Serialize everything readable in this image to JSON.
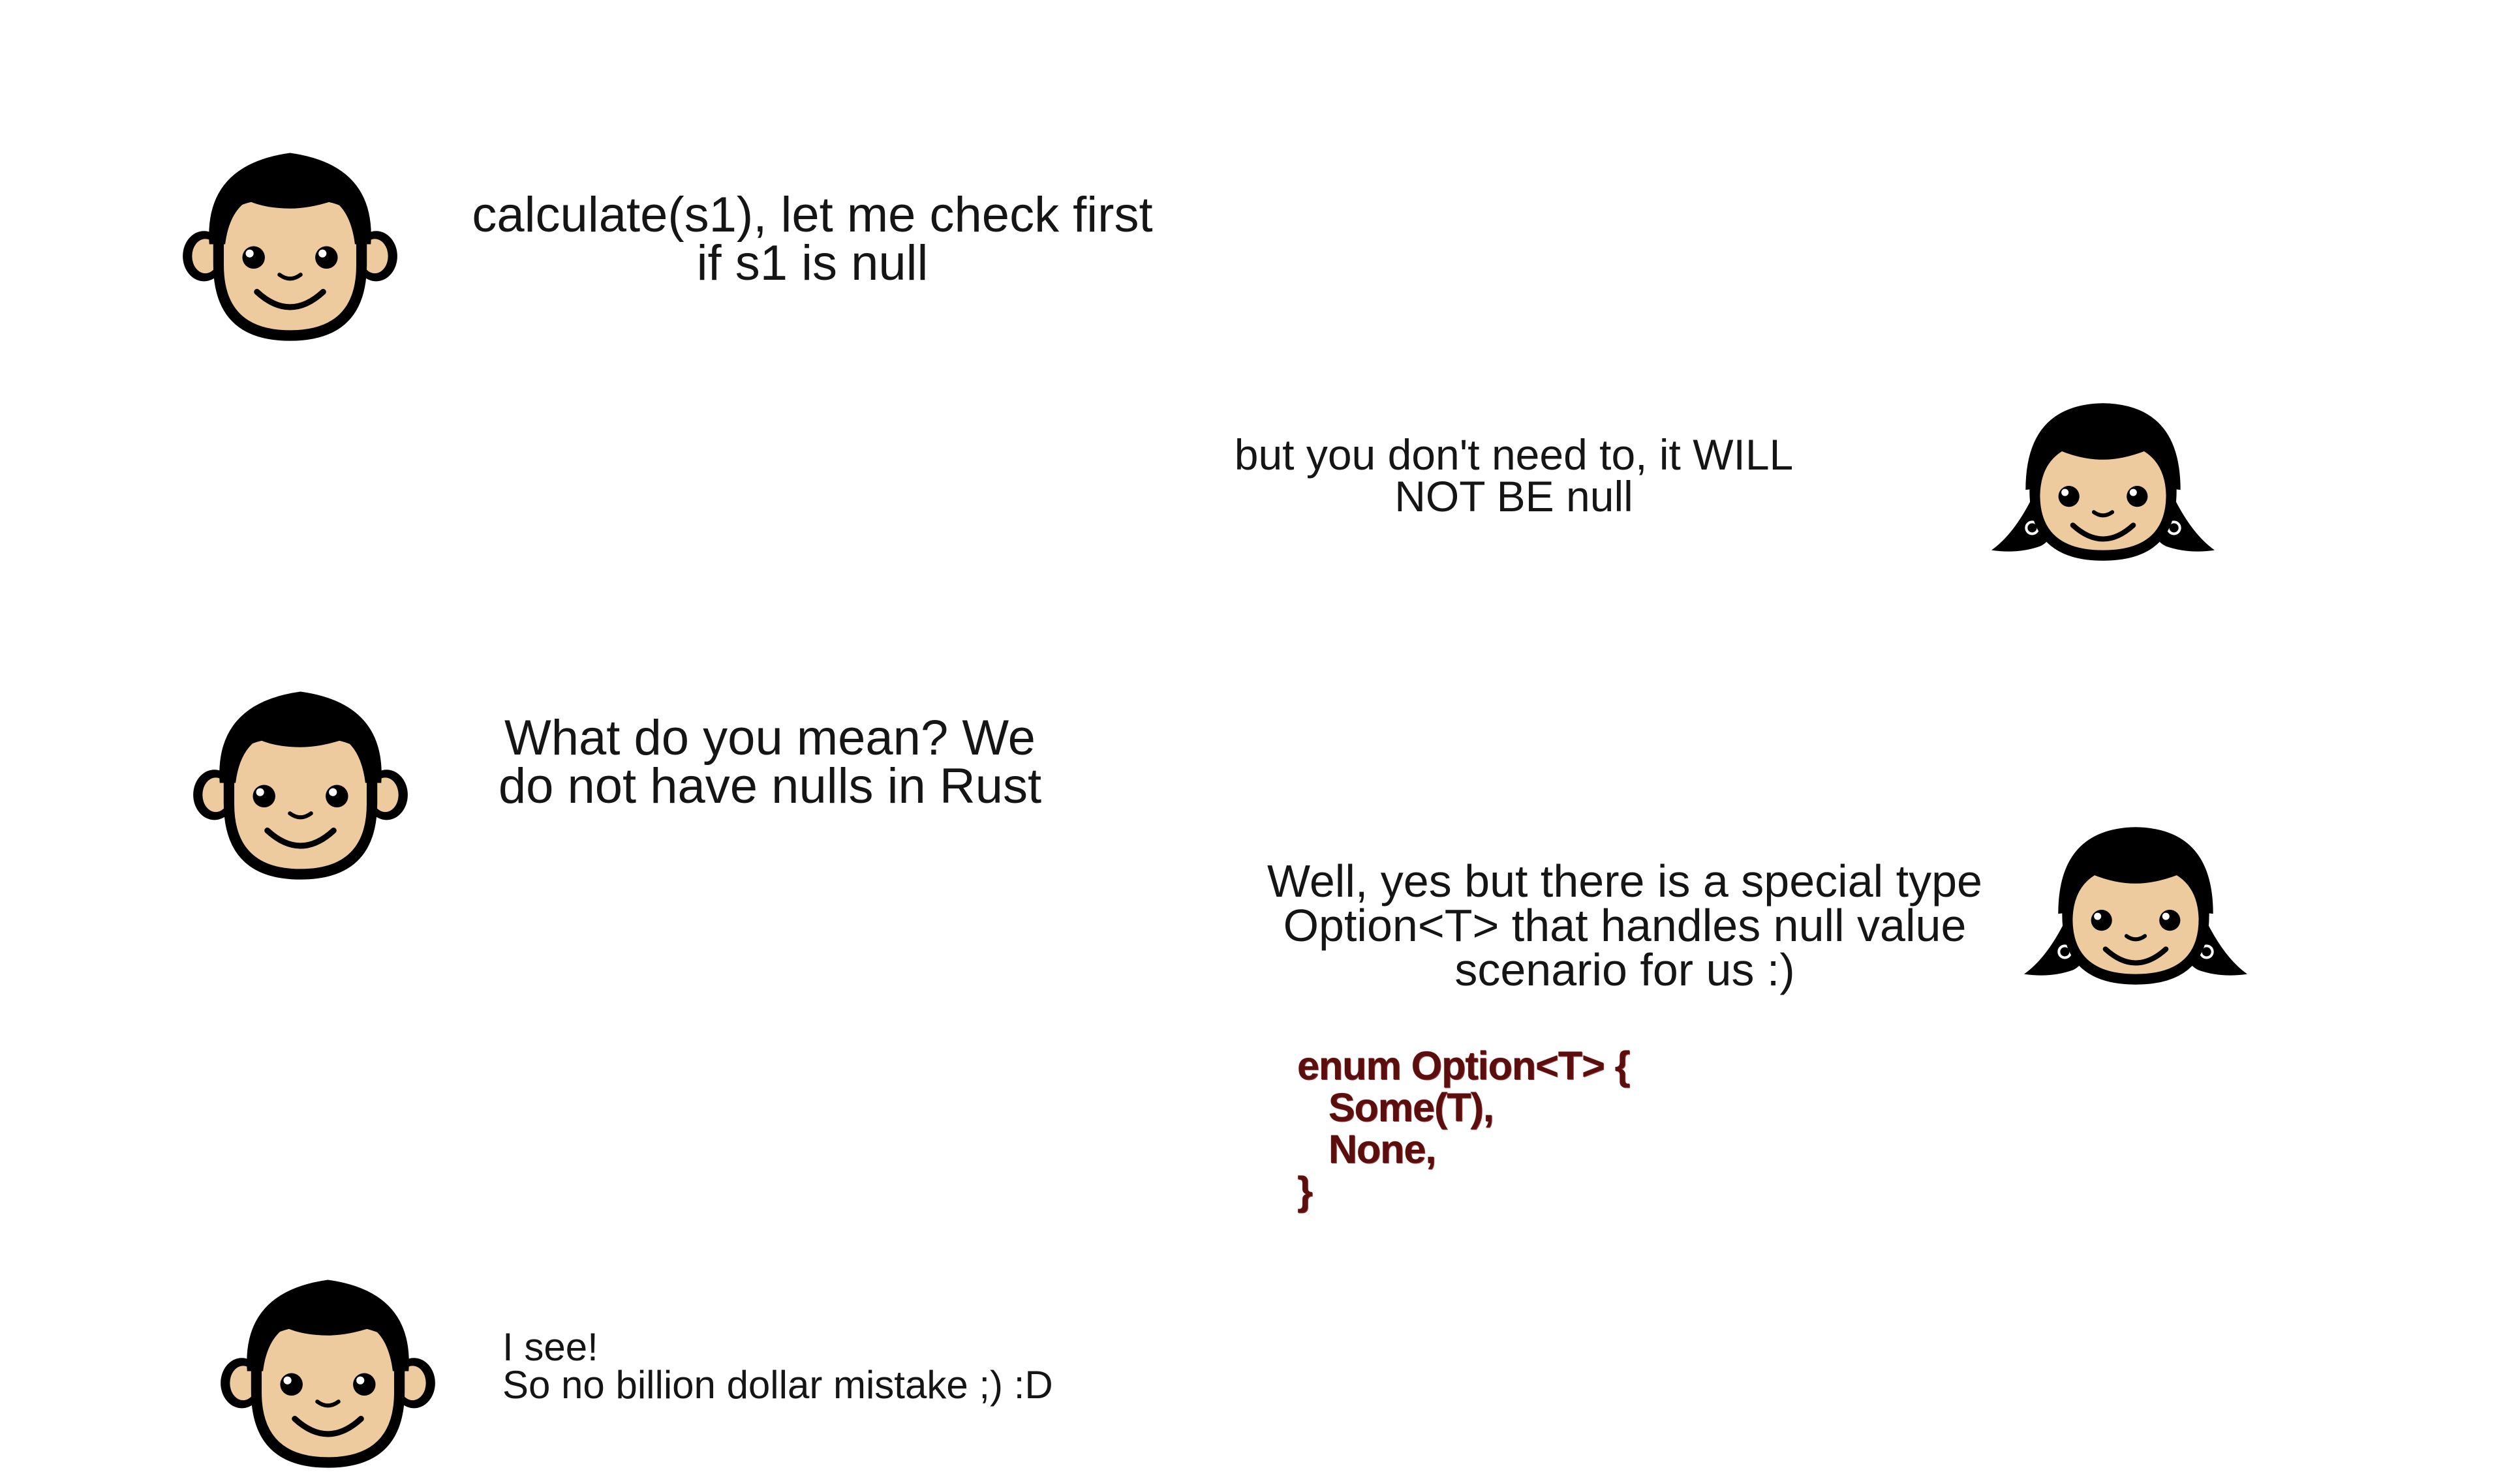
{
  "colors": {
    "background": "#ffffff",
    "text": "#151515",
    "code_fill": "#5a0e0e",
    "code_outline": "#9c3a3a",
    "skin": "#eecb9e",
    "hair": "#000000"
  },
  "conversation": [
    {
      "speaker": "boy",
      "icon": "boy-face-icon",
      "lines": [
        "calculate(s1), let me check first",
        "if s1 is null"
      ]
    },
    {
      "speaker": "girl",
      "icon": "girl-face-icon",
      "lines": [
        "but you don't need to, it WILL",
        "NOT BE null"
      ]
    },
    {
      "speaker": "boy",
      "icon": "boy-face-icon",
      "lines": [
        "What do you mean? We",
        "do not have nulls in Rust"
      ]
    },
    {
      "speaker": "girl",
      "icon": "girl-face-icon",
      "lines": [
        "Well, yes but there is a special type",
        "Option<T> that handles null value",
        "scenario for us :)"
      ],
      "code": [
        "enum Option<T> {",
        "   Some(T),",
        "   None,",
        "}"
      ]
    },
    {
      "speaker": "boy",
      "icon": "boy-face-icon",
      "lines": [
        "I see!",
        "So no billion dollar mistake ;) :D"
      ]
    }
  ]
}
